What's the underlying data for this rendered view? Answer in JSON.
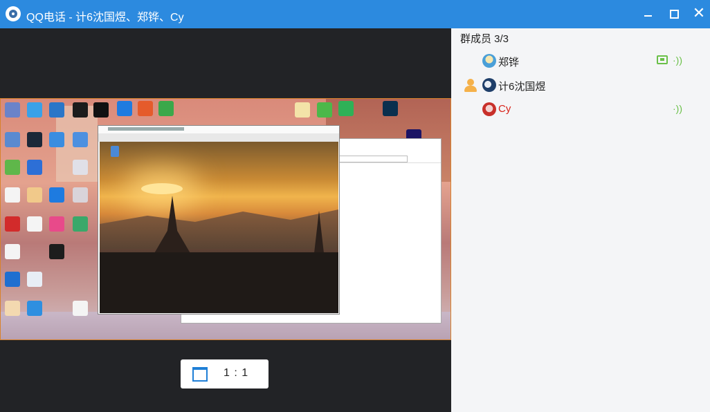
{
  "window": {
    "title": "QQ电话 - 计6沈国煜、郑铧、Cy",
    "minimize_icon": "minimize-icon",
    "maximize_icon": "maximize-icon",
    "close_glyph": "✕"
  },
  "video": {
    "ratio_label": "1 : 1",
    "ratio_icon": "window-ratio-icon"
  },
  "members": {
    "header": "群成员 3/3",
    "list": [
      {
        "name": "郑铧",
        "host": false,
        "sharing_screen": true,
        "speaking": true,
        "name_color": "#222222"
      },
      {
        "name": "计6沈国煜",
        "host": true,
        "sharing_screen": false,
        "speaking": false,
        "name_color": "#222222"
      },
      {
        "name": "Cy",
        "host": false,
        "sharing_screen": false,
        "speaking": true,
        "name_color": "#d8231a"
      }
    ],
    "voice_glyph": "·))"
  },
  "colors": {
    "titlebar": "#2c8adf",
    "video_bg": "#222326",
    "panel_bg": "#f4f5f7",
    "share_border": "#d9822b",
    "active_green": "#6ac048"
  }
}
